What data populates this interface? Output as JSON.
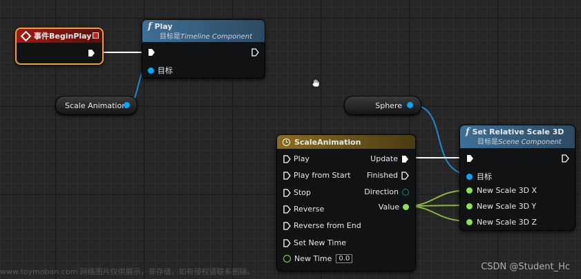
{
  "colors": {
    "exec_wire": "#ffffff",
    "object_pin": "#00a6ff",
    "vector_pin": "#a0d04a",
    "event_header": "#9e1a12",
    "event_border": "#f2a02a",
    "function_header": "#3f6f95",
    "timeline_header": "#8a6d1e"
  },
  "begin_play": {
    "icon": "event-diamond-icon",
    "title": "事件BeginPlay"
  },
  "play_node": {
    "icon": "function-icon",
    "glyph": "f",
    "title": "Play",
    "subtitle_prefix": "目标是",
    "subtitle_target": "Timeline Component",
    "target_label": "目标"
  },
  "scale_animation_var": {
    "label": "Scale Animation"
  },
  "sphere_var": {
    "label": "Sphere"
  },
  "timeline_node": {
    "icon": "clock-icon",
    "title": "ScaleAnimation",
    "inputs": [
      "Play",
      "Play from Start",
      "Stop",
      "Reverse",
      "Reverse from End",
      "Set New Time"
    ],
    "new_time_label": "New Time",
    "new_time_value": "0.0",
    "outputs": {
      "update": "Update",
      "finished": "Finished",
      "direction": "Direction",
      "value": "Value"
    }
  },
  "set_scale_node": {
    "icon": "function-icon",
    "glyph": "f",
    "title": "Set Relative Scale 3D",
    "subtitle_prefix": "目标是",
    "subtitle_target": "Scene Component",
    "target_label": "目标",
    "inputs": [
      "New Scale 3D X",
      "New Scale 3D Y",
      "New Scale 3D Z"
    ]
  },
  "watermark": {
    "left": "www.toymoban.com 网络图片仅供展示，非存储，如有侵权请联系删除。",
    "right": "CSDN @Student_Hc"
  }
}
